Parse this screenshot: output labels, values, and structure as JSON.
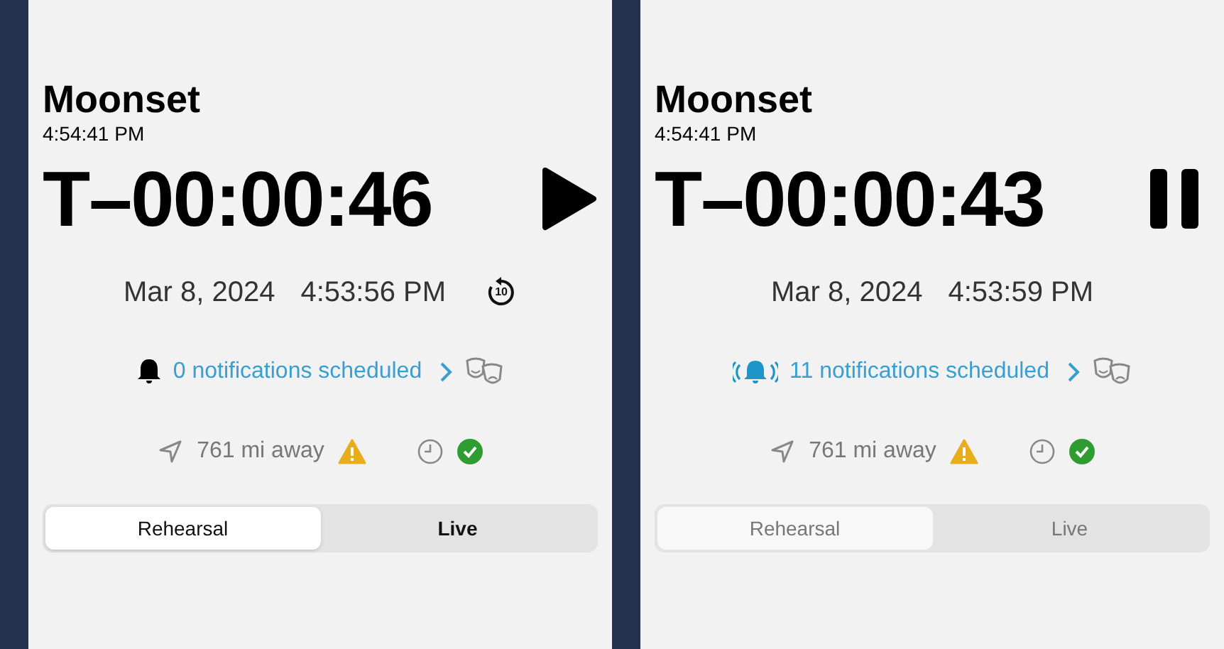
{
  "panels": [
    {
      "title": "Moonset",
      "time": "4:54:41 PM",
      "countdown": "T–00:00:46",
      "playing": false,
      "date": "Mar 8, 2024",
      "clock": "4:53:56 PM",
      "replay": {
        "shown": true,
        "label": "10"
      },
      "notifications": {
        "text": "0 notifications scheduled",
        "ringing": false
      },
      "distance": "761 mi away",
      "modes_disabled": false,
      "modes": [
        {
          "label": "Rehearsal",
          "selected": true
        },
        {
          "label": "Live",
          "selected": false
        }
      ]
    },
    {
      "title": "Moonset",
      "time": "4:54:41 PM",
      "countdown": "T–00:00:43",
      "playing": true,
      "date": "Mar 8, 2024",
      "clock": "4:53:59 PM",
      "notifications": {
        "text": "11 notifications scheduled",
        "ringing": true
      },
      "distance": "761 mi away",
      "modes_disabled": true,
      "modes": [
        {
          "label": "Rehearsal",
          "selected": true
        },
        {
          "label": "Live",
          "selected": false
        }
      ]
    }
  ]
}
